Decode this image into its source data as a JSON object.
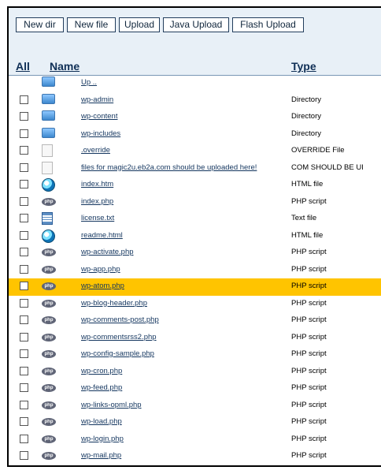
{
  "toolbar": {
    "buttons": [
      {
        "label": "New dir"
      },
      {
        "label": "New file"
      },
      {
        "label": "Upload"
      },
      {
        "label": "Java Upload"
      },
      {
        "label": "Flash Upload"
      }
    ]
  },
  "columns": {
    "all": "All",
    "name": "Name",
    "type": "Type"
  },
  "files": [
    {
      "name": "Up ..",
      "type": "",
      "icon": "folder-up-icon",
      "selected": false,
      "checkbox": false
    },
    {
      "name": "wp-admin",
      "type": "Directory",
      "icon": "folder-icon",
      "selected": false,
      "checkbox": true
    },
    {
      "name": "wp-content",
      "type": "Directory",
      "icon": "folder-icon",
      "selected": false,
      "checkbox": true
    },
    {
      "name": "wp-includes",
      "type": "Directory",
      "icon": "folder-icon",
      "selected": false,
      "checkbox": true
    },
    {
      "name": ".override",
      "type": "OVERRIDE File",
      "icon": "document-icon",
      "selected": false,
      "checkbox": true
    },
    {
      "name": "files for magic2u.eb2a.com should be uploaded here!",
      "type": "COM SHOULD BE UI",
      "icon": "document-icon",
      "selected": false,
      "checkbox": true
    },
    {
      "name": "index.htm",
      "type": "HTML file",
      "icon": "html-icon",
      "selected": false,
      "checkbox": true
    },
    {
      "name": "index.php",
      "type": "PHP script",
      "icon": "php-icon",
      "selected": false,
      "checkbox": true
    },
    {
      "name": "license.txt",
      "type": "Text file",
      "icon": "text-file-icon",
      "selected": false,
      "checkbox": true
    },
    {
      "name": "readme.html",
      "type": "HTML file",
      "icon": "html-icon",
      "selected": false,
      "checkbox": true
    },
    {
      "name": "wp-activate.php",
      "type": "PHP script",
      "icon": "php-icon",
      "selected": false,
      "checkbox": true
    },
    {
      "name": "wp-app.php",
      "type": "PHP script",
      "icon": "php-icon",
      "selected": false,
      "checkbox": true
    },
    {
      "name": "wp-atom.php",
      "type": "PHP script",
      "icon": "php-icon",
      "selected": true,
      "checkbox": true
    },
    {
      "name": "wp-blog-header.php",
      "type": "PHP script",
      "icon": "php-icon",
      "selected": false,
      "checkbox": true
    },
    {
      "name": "wp-comments-post.php",
      "type": "PHP script",
      "icon": "php-icon",
      "selected": false,
      "checkbox": true
    },
    {
      "name": "wp-commentsrss2.php",
      "type": "PHP script",
      "icon": "php-icon",
      "selected": false,
      "checkbox": true
    },
    {
      "name": "wp-config-sample.php",
      "type": "PHP script",
      "icon": "php-icon",
      "selected": false,
      "checkbox": true
    },
    {
      "name": "wp-cron.php",
      "type": "PHP script",
      "icon": "php-icon",
      "selected": false,
      "checkbox": true
    },
    {
      "name": "wp-feed.php",
      "type": "PHP script",
      "icon": "php-icon",
      "selected": false,
      "checkbox": true
    },
    {
      "name": "wp-links-opml.php",
      "type": "PHP script",
      "icon": "php-icon",
      "selected": false,
      "checkbox": true
    },
    {
      "name": "wp-load.php",
      "type": "PHP script",
      "icon": "php-icon",
      "selected": false,
      "checkbox": true
    },
    {
      "name": "wp-login.php",
      "type": "PHP script",
      "icon": "php-icon",
      "selected": false,
      "checkbox": true
    },
    {
      "name": "wp-mail.php",
      "type": "PHP script",
      "icon": "php-icon",
      "selected": false,
      "checkbox": true
    }
  ],
  "colors": {
    "toolbar_bg": "#e8f0f7",
    "selected_row": "#ffc400",
    "link": "#14365f"
  }
}
